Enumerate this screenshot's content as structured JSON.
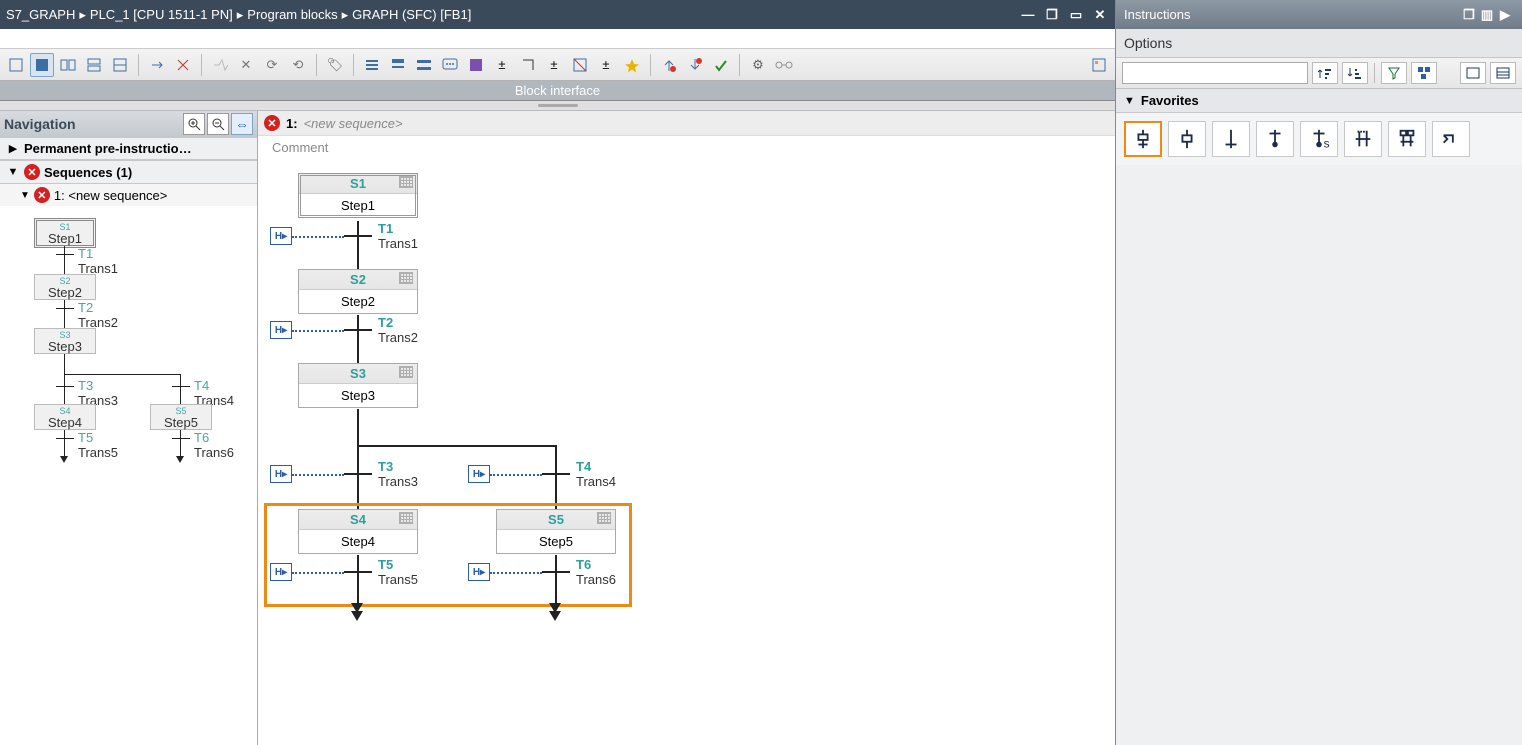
{
  "titlebar": {
    "crumbs": [
      "S7_GRAPH",
      "PLC_1 [CPU 1511-1 PN]",
      "Program blocks",
      "GRAPH (SFC) [FB1]"
    ]
  },
  "block_interface": "Block interface",
  "navigation": {
    "title": "Navigation",
    "rows": {
      "pre": "Permanent pre-instructio…",
      "sequences": "Sequences (1)",
      "seq1": "1: <new sequence>"
    },
    "mini": {
      "s1": {
        "id": "S1",
        "name": "Step1"
      },
      "s2": {
        "id": "S2",
        "name": "Step2"
      },
      "s3": {
        "id": "S3",
        "name": "Step3"
      },
      "s4": {
        "id": "S4",
        "name": "Step4"
      },
      "s5": {
        "id": "S5",
        "name": "Step5"
      },
      "t1": {
        "id": "T1",
        "name": "Trans1"
      },
      "t2": {
        "id": "T2",
        "name": "Trans2"
      },
      "t3": {
        "id": "T3",
        "name": "Trans3"
      },
      "t4": {
        "id": "T4",
        "name": "Trans4"
      },
      "t5": {
        "id": "T5",
        "name": "Trans5"
      },
      "t6": {
        "id": "T6",
        "name": "Trans6"
      }
    }
  },
  "sequence": {
    "num": "1:",
    "name": "<new sequence>",
    "comment": "Comment",
    "steps": {
      "s1": {
        "id": "S1",
        "name": "Step1"
      },
      "s2": {
        "id": "S2",
        "name": "Step2"
      },
      "s3": {
        "id": "S3",
        "name": "Step3"
      },
      "s4": {
        "id": "S4",
        "name": "Step4"
      },
      "s5": {
        "id": "S5",
        "name": "Step5"
      }
    },
    "trans": {
      "t1": {
        "id": "T1",
        "name": "Trans1"
      },
      "t2": {
        "id": "T2",
        "name": "Trans2"
      },
      "t3": {
        "id": "T3",
        "name": "Trans3"
      },
      "t4": {
        "id": "T4",
        "name": "Trans4"
      },
      "t5": {
        "id": "T5",
        "name": "Trans5"
      },
      "t6": {
        "id": "T6",
        "name": "Trans6"
      }
    }
  },
  "instructions": {
    "title": "Instructions",
    "options": "Options",
    "favorites": "Favorites",
    "search_ph": ""
  }
}
